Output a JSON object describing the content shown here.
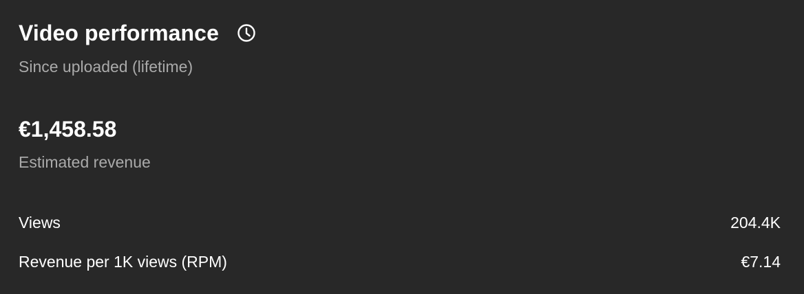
{
  "header": {
    "title": "Video performance",
    "title_icon": "clock-icon",
    "subtitle": "Since uploaded (lifetime)"
  },
  "revenue": {
    "value": "€1,458.58",
    "label": "Estimated revenue"
  },
  "metrics": [
    {
      "label": "Views",
      "value": "204.4K"
    },
    {
      "label": "Revenue per 1K views (RPM)",
      "value": "€7.14"
    }
  ],
  "colors": {
    "background": "#282828",
    "primary_text": "#ffffff",
    "secondary_text": "#aaaaaa"
  }
}
